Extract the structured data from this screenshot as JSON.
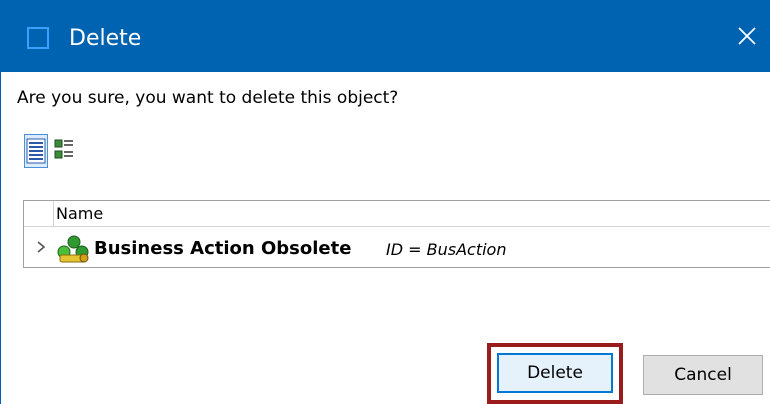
{
  "dialog": {
    "title": "Delete",
    "prompt": "Are you sure, you want to delete this object?"
  },
  "tree": {
    "column_header": "Name",
    "rows": [
      {
        "name": "Business Action Obsolete",
        "id_text": "ID = BusAction"
      }
    ]
  },
  "buttons": {
    "delete_label": "Delete",
    "cancel_label": "Cancel"
  },
  "icons": {
    "title": "window-icon",
    "close": "close-icon",
    "list_view": "list-view-icon",
    "detail_view": "detail-view-icon",
    "expander": "chevron-right-icon",
    "object": "business-action-icon"
  },
  "colors": {
    "titlebar": "#0063b1",
    "highlight": "#9b1c1c",
    "default_button_border": "#0078d7"
  }
}
